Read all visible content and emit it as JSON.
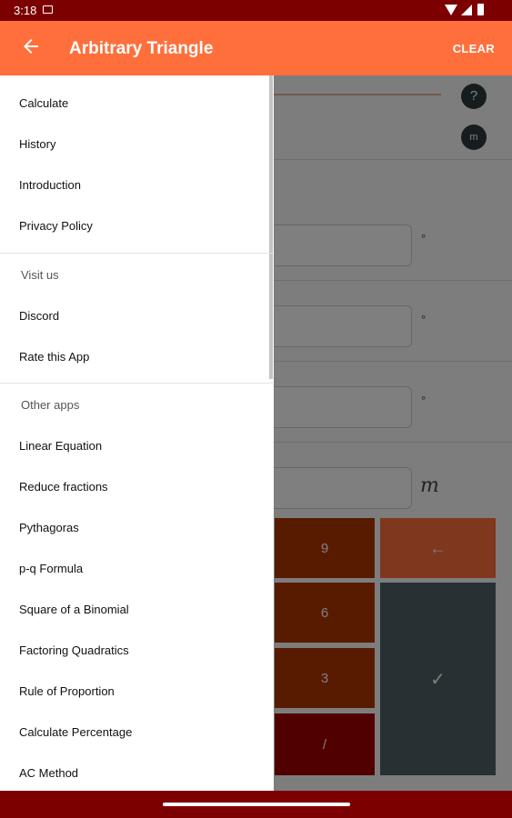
{
  "status_bar": {
    "time": "3:18"
  },
  "app_bar": {
    "title": "Arbitrary Triangle",
    "clear_label": "CLEAR",
    "back_icon": "arrow-left-icon"
  },
  "background": {
    "help_icon_text": "?",
    "unit_icon_text": "m",
    "unit_degree": "°",
    "unit_meter": "m",
    "keys": [
      "9",
      "6",
      "3",
      "/"
    ],
    "backspace_glyph": "←",
    "confirm_glyph": "✓"
  },
  "drawer": {
    "items_top": [
      "Calculate",
      "History",
      "Introduction",
      "Privacy Policy"
    ],
    "visit_header": "Visit us",
    "items_visit": [
      "Discord",
      "Rate this App"
    ],
    "other_header": "Other apps",
    "items_other": [
      "Linear Equation",
      "Reduce fractions",
      "Pythagoras",
      "p-q Formula",
      "Square of a Binomial",
      "Factoring Quadratics",
      "Rule of Proportion",
      "Calculate Percentage",
      "AC Method"
    ]
  },
  "colors": {
    "app_bar": "#ff6f3c",
    "status_bar": "#7d0000",
    "confirm_key": "#4e6268"
  }
}
